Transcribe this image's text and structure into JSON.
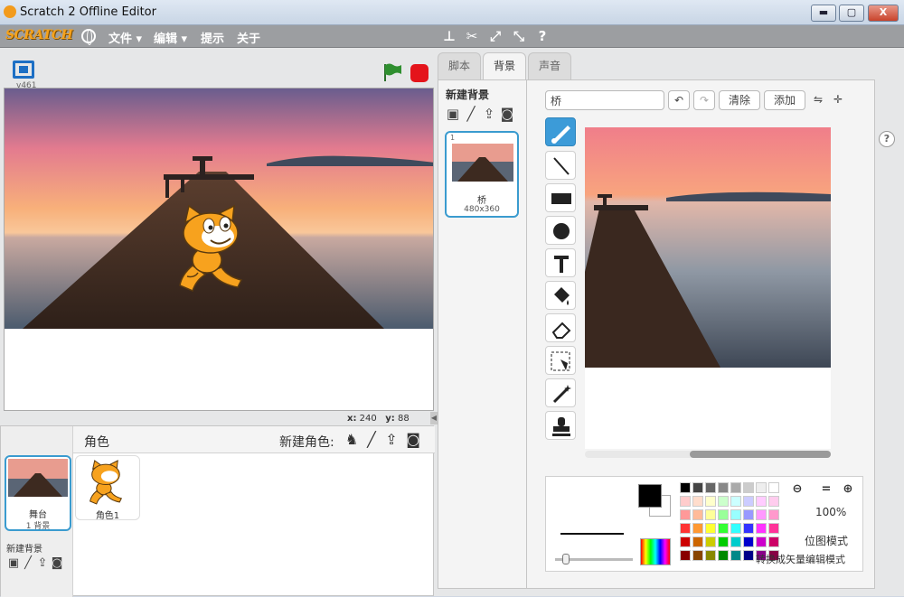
{
  "window": {
    "title": "Scratch 2 Offline Editor",
    "min_label": "▬",
    "max_label": "▢",
    "close_label": "X"
  },
  "menubar": {
    "logo": "SCRATCH",
    "menus": [
      "文件 ▾",
      "编辑 ▾",
      "提示",
      "关于"
    ]
  },
  "stage": {
    "version": "v461",
    "x_label": "x:",
    "x_value": "240",
    "y_label": "y:",
    "y_value": "88"
  },
  "sprites": {
    "header": "角色",
    "new_sprite_label": "新建角色:",
    "stage_name": "舞台",
    "stage_backdrops": "1 背景",
    "new_backdrop_label": "新建背景",
    "items": [
      {
        "name": "角色1"
      }
    ]
  },
  "tabs": [
    "脚本",
    "背景",
    "声音"
  ],
  "costumes": {
    "new_label": "新建背景",
    "items": [
      {
        "index": "1",
        "name": "桥",
        "size": "480x360"
      }
    ]
  },
  "editor": {
    "name_value": "桥",
    "clear_label": "清除",
    "add_label": "添加",
    "zoom_level": "100%",
    "mode_label": "位图模式",
    "convert_label": "转换成矢量编辑模式"
  },
  "colors": {
    "accent": "#3a9bcf",
    "active_tool": "#3c9bd8",
    "stop": "#e4141b",
    "flag": "#2f8f2f"
  }
}
